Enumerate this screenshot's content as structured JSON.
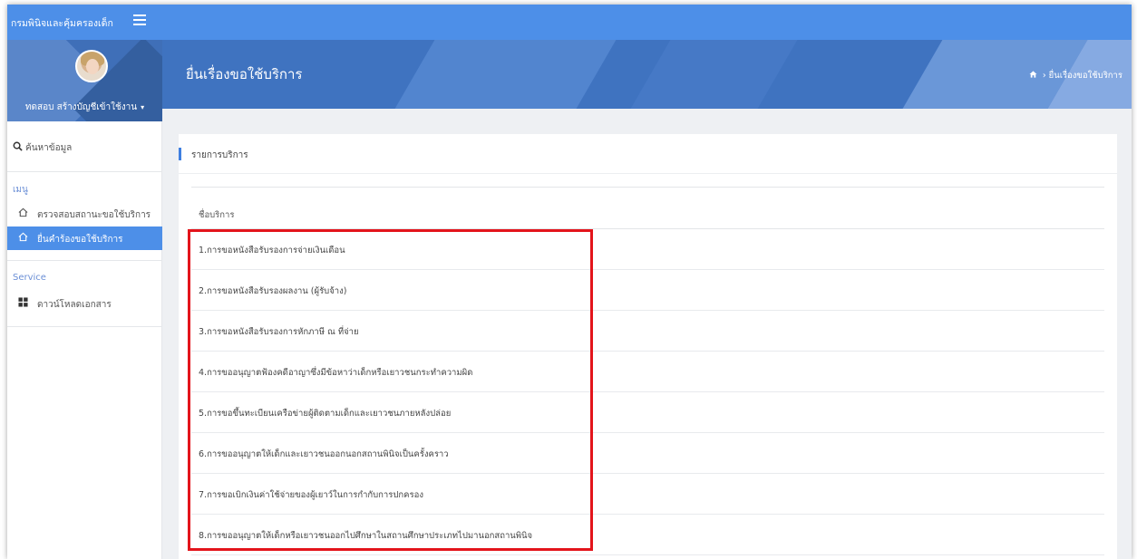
{
  "app": {
    "brand": "กรมพินิจและคุ้มครองเด็ก"
  },
  "profile": {
    "user_name": "ทดสอบ สร้างบัญชีเข้าใช้งาน",
    "caret": "▾"
  },
  "sidebar": {
    "search_label": "ค้นหาข้อมูล",
    "menu_title": "เมนู",
    "menu_items": [
      {
        "label": "ตรวจสอบสถานะขอใช้บริการ",
        "icon": "home-icon",
        "active": false
      },
      {
        "label": "ยื่นคำร้องขอใช้บริการ",
        "icon": "home-icon",
        "active": true
      }
    ],
    "service_title": "Service",
    "service_items": [
      {
        "label": "ดาวน์โหลดเอกสาร",
        "icon": "grid-icon"
      }
    ]
  },
  "header": {
    "title": "ยื่นเรื่องขอใช้บริการ",
    "breadcrumb": "› ยื่นเรื่องขอใช้บริการ",
    "home_icon": "home-icon"
  },
  "card": {
    "title": "รายการบริการ",
    "column_header": "ชื่อบริการ",
    "rows": [
      "1.การขอหนังสือรับรองการจ่ายเงินเดือน",
      "2.การขอหนังสือรับรองผลงาน (ผู้รับจ้าง)",
      "3.การขอหนังสือรับรองการหักภาษี ณ ที่จ่าย",
      "4.การขออนุญาตฟ้องคดีอาญาซึ่งมีข้อหาว่าเด็กหรือเยาวชนกระทำความผิด",
      "5.การขอขึ้นทะเบียนเครือข่ายผู้ติดตามเด็กและเยาวชนภายหลังปล่อย",
      "6.การขออนุญาตให้เด็กและเยาวชนออกนอกสถานพินิจเป็นครั้งคราว",
      "7.การขอเบิกเงินค่าใช้จ่ายของผู้เยาว์ในการกำกับการปกครอง",
      "8.การขออนุญาตให้เด็กหรือเยาวชนออกไปศึกษาในสถานศึกษาประเภทไปมานอกสถานพินิจ"
    ]
  },
  "colors": {
    "accent": "#4d8fe8",
    "highlight": "#e3141b",
    "header": "#3f73c0"
  }
}
